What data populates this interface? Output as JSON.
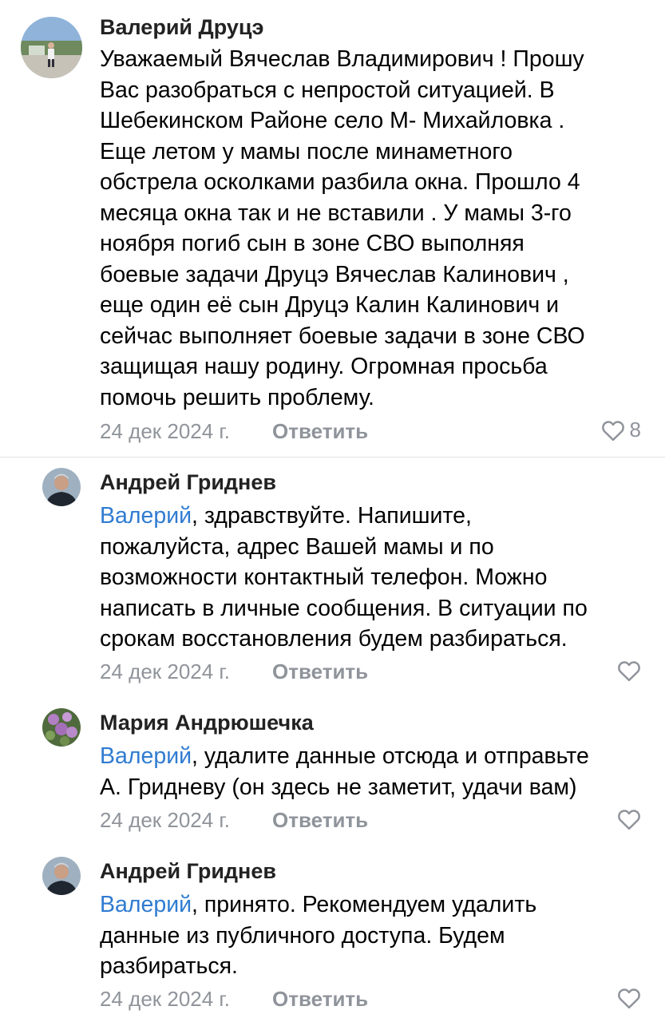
{
  "colors": {
    "mention": "#2f7bd1",
    "meta": "#8f949b",
    "divider": "#e1e3e6"
  },
  "comments": [
    {
      "author": "Валерий Друцэ",
      "lines": [
        "Уважаемый Вячеслав Владимирович ! Прошу",
        "Вас разобраться с непростой ситуацией. В",
        "Шебекинском  Районе село М- Михайловка .",
        "Еще летом у мамы после минаметного",
        "обстрела осколками разбила окна. Прошло 4",
        "месяца окна так и не вставили . У мамы 3-го",
        "ноября погиб сын в зоне СВО выполняя",
        "боевые задачи Друцэ Вячеслав Калинович ,",
        "еще один её сын Друцэ Калин Калинович и",
        "сейчас выполняет боевые задачи в зоне СВО",
        "защищая нашу родину. Огромная просьба",
        "помочь решить проблему."
      ],
      "date": "24 дек 2024 г.",
      "reply_label": "Ответить",
      "likes": "8",
      "like_icon": "heart-outline-icon"
    },
    {
      "author": "Андрей Гриднев",
      "mention": "Валерий",
      "first_line_rest": ", здравствуйте. Напишите,",
      "lines": [
        "пожалуйста, адрес Вашей мамы и по",
        "возможности контактный телефон. Можно",
        "написать в личные сообщения. В ситуации по",
        "срокам восстановления будем разбираться."
      ],
      "date": "24 дек 2024 г.",
      "reply_label": "Ответить",
      "like_icon": "heart-outline-icon"
    },
    {
      "author": "Мария Андрюшечка",
      "mention": "Валерий",
      "first_line_rest": ", удалите данные отсюда и отправьте",
      "lines": [
        "А. Гридневу (он здесь не заметит, удачи вам)"
      ],
      "date": "24 дек 2024 г.",
      "reply_label": "Ответить",
      "like_icon": "heart-outline-icon"
    },
    {
      "author": "Андрей Гриднев",
      "mention": "Валерий",
      "first_line_rest": ", принято. Рекомендуем удалить",
      "lines": [
        "данные из публичного доступа. Будем",
        "разбираться."
      ],
      "date": "24 дек 2024 г.",
      "reply_label": "Ответить",
      "like_icon": "heart-outline-icon"
    }
  ]
}
